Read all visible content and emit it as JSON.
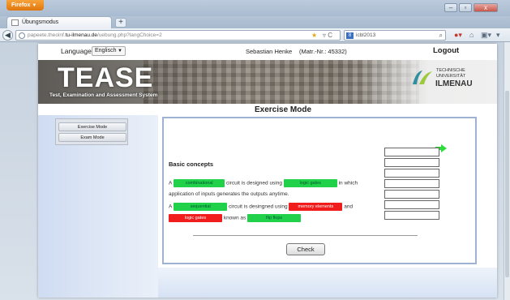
{
  "browser": {
    "app_button": "Firefox",
    "tab_title": "Übungsmodus",
    "url_prefix": "papeete.theoinf.",
    "url_host": "tu-ilmenau.de",
    "url_path": "/uebung.php?langChoice=2",
    "search_text": "icbl2013",
    "search_engine_icon": "google-icon"
  },
  "header": {
    "language_label": "Language:",
    "language_value": "Englisch",
    "user_name": "Sebastian Henke",
    "matriculation": "(Matr.-Nr.: 45332)",
    "logout": "Logout"
  },
  "banner": {
    "brand": "TEASE",
    "brand_subtitle": "Test, Examination and Assessment System",
    "university_line1": "TECHNISCHE",
    "university_line2": "UNIVERSITÄT",
    "university_name": "ILMENAU"
  },
  "main": {
    "title": "Exercise Mode",
    "sidebar": [
      "Exercise Mode",
      "Exam Mode"
    ],
    "section_title": "Basic concepts",
    "sentences": {
      "l1_a": "A",
      "chip_combinational": "combinational",
      "l1_b": "circuit is designed using",
      "chip_logic_gates_1": "logic gates",
      "l1_c": "in which",
      "l2": "application of inputs generates the outputs anytime.",
      "l3_a": "A",
      "chip_sequential": "sequential",
      "l3_b": "circuit is desingned using",
      "chip_memory_elements": "memory elements",
      "l3_c": "and",
      "chip_logic_gates_2": "logic gates",
      "l4_a": "known as",
      "chip_flip_flops": "flip flops"
    },
    "answer_fields": [
      "",
      "",
      "",
      "",
      "",
      "",
      ""
    ],
    "check_button": "Check"
  },
  "colors": {
    "chip_green": "#22d14a",
    "chip_red": "#f11d1d",
    "next_arrow": "#2bdc3a",
    "content_border": "#9eb2d3"
  }
}
